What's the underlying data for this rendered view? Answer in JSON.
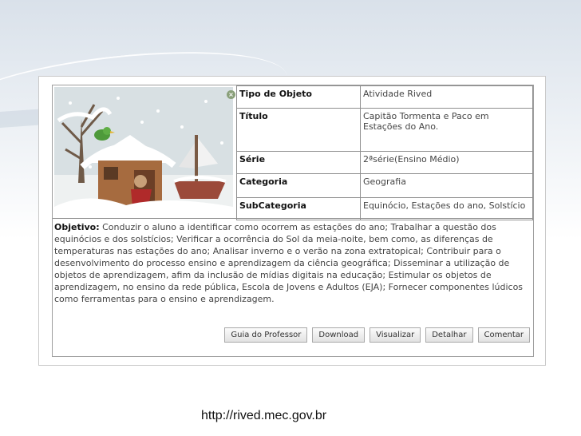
{
  "details": {
    "rows": [
      {
        "key": "Tipo de Objeto",
        "value": "Atividade Rived"
      },
      {
        "key": "Título",
        "value": "Capitão Tormenta e Paco em Estações do Ano."
      },
      {
        "key": "Série",
        "value": "2ªsérie(Ensino Médio)"
      },
      {
        "key": "Categoria",
        "value": "Geografia"
      },
      {
        "key": "SubCategoria",
        "value": "Equinócio, Estações do ano, Solstício"
      }
    ]
  },
  "objective": {
    "label": "Objetivo:",
    "text": "Conduzir o aluno a identificar como ocorrem as estações do ano; Trabalhar a questão dos equinócios e dos solstícios; Verificar a ocorrência do Sol da meia-noite, bem como, as diferenças de temperaturas nas estações do ano; Analisar inverno e o verão na zona extratopical; Contribuir para o desenvolvimento do processo ensino e aprendizagem da ciência geográfica; Disseminar a utilização de objetos de aprendizagem, afim da inclusão de mídias digitais na educação; Estimular os objetos de aprendizagem, no ensino da rede pública, Escola de Jovens e Adultos (EJA); Fornecer componentes lúdicos como ferramentas para o ensino e aprendizagem."
  },
  "actions": {
    "guide": "Guia do Professor",
    "download": "Download",
    "view": "Visualizar",
    "detail": "Detalhar",
    "comment": "Comentar"
  },
  "footer": {
    "url": "http://rived.mec.gov.br"
  }
}
